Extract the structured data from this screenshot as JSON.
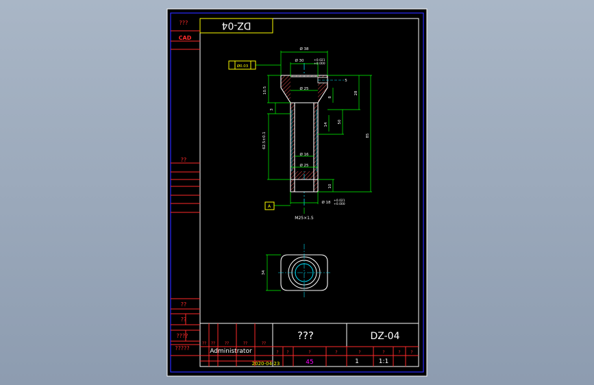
{
  "title_rev": "DZ-04",
  "cad_label": "CAD",
  "side_labels": {
    "top_left": "???",
    "mid": "??",
    "bottom_1": "??",
    "bottom_2": "??",
    "bottom_3": "????",
    "bottom_4": "?????"
  },
  "title_block": {
    "part_name": "???",
    "drawing_no": "DZ-04",
    "author": "Administrator",
    "date": "2020-04-23",
    "material": "45",
    "quantity": "1",
    "scale": "1:1",
    "header_marks": [
      "??",
      "??",
      "??",
      "??",
      "??"
    ],
    "row_marks": [
      "?",
      "?",
      "?",
      "?",
      "?",
      "?",
      "?",
      "?"
    ]
  },
  "dimensions": {
    "od_top": "Ø 38",
    "bore_top": "Ø 30",
    "bore_top_tol": "+0.021\n+0.000",
    "bore_mid": "Ø 25",
    "flange_h": "10.5",
    "bore_small": "Ø 16",
    "bore_small_b": "Ø 25",
    "len_total": "85",
    "len_a": "28",
    "len_b": "50",
    "len_c": "14",
    "len_d": "5",
    "len_e": "10",
    "len_f": "8",
    "len_g": "3",
    "shaft_len": "62.5±0.1",
    "tip_d": "Ø 18",
    "tip_tol": "+0.021\n+0.000",
    "thread": "M25×1.5",
    "tol_frame": "Ø0.03",
    "datum": "A",
    "end_view_dim": "34"
  },
  "colors": {
    "border": "#2a2aff",
    "frame": "#ffffff",
    "red": "#ff2a2a",
    "green": "#00ff00",
    "yellow": "#ffff00",
    "cyan": "#00e5ff",
    "magenta": "#ff00ff",
    "hatch": "#cc4444"
  }
}
